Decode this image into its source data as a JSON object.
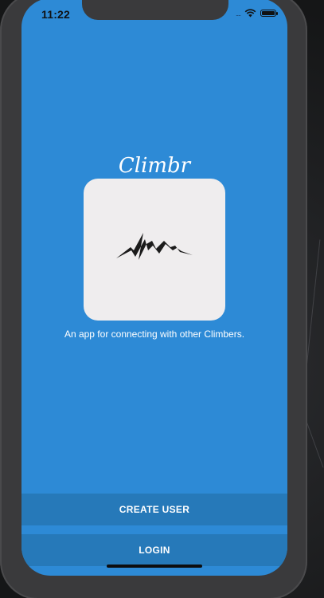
{
  "status_bar": {
    "time": "11:22",
    "signal_glyph": "....",
    "wifi_icon": "wifi-icon",
    "battery_icon": "battery-icon"
  },
  "app": {
    "title": "Climbr",
    "logo_icon": "mountain-icon",
    "tagline": "An app for connecting with other Climbers."
  },
  "actions": {
    "create_user_label": "CREATE USER",
    "login_label": "LOGIN"
  },
  "colors": {
    "screen_background": "#2d8ad6",
    "button_background": "#2679b9",
    "logo_card": "#efedee",
    "text": "#ffffff"
  }
}
